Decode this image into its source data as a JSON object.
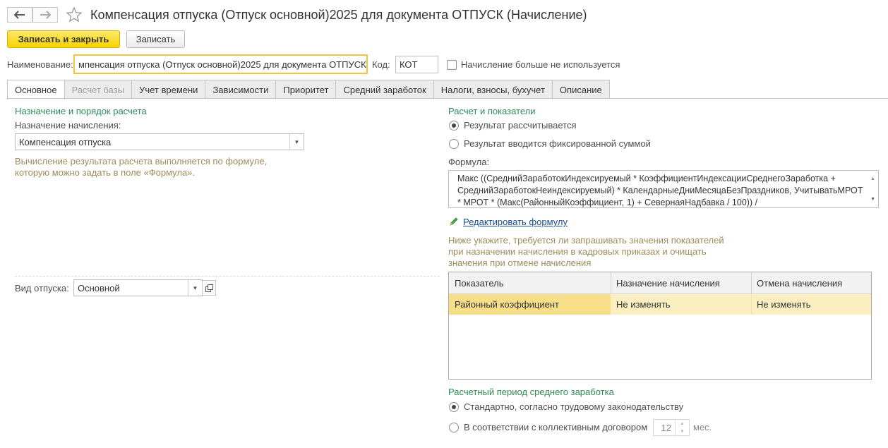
{
  "header": {
    "title": "Компенсация отпуска (Отпуск основной)2025 для документа ОТПУСК (Начисление)",
    "save_close_label": "Записать и закрыть",
    "save_label": "Записать"
  },
  "fields": {
    "name_label": "Наименование:",
    "name_value": "мпенсация отпуска (Отпуск основной)2025 для документа ОТПУСК",
    "code_label": "Код:",
    "code_value": "КОТ",
    "unused_label": "Начисление больше не используется"
  },
  "tabs": [
    {
      "label": "Основное"
    },
    {
      "label": "Расчет базы"
    },
    {
      "label": "Учет времени"
    },
    {
      "label": "Зависимости"
    },
    {
      "label": "Приоритет"
    },
    {
      "label": "Средний заработок"
    },
    {
      "label": "Налоги, взносы, бухучет"
    },
    {
      "label": "Описание"
    }
  ],
  "left": {
    "section_title": "Назначение и порядок расчета",
    "purpose_label": "Назначение начисления:",
    "purpose_value": "Компенсация отпуска",
    "hint": "Вычисление результата расчета выполняется по формуле, которую можно задать в поле «Формула».",
    "vacation_kind_label": "Вид отпуска:",
    "vacation_kind_value": "Основной"
  },
  "right": {
    "section_title": "Расчет и показатели",
    "radio_calculated": "Результат рассчитывается",
    "radio_fixed": "Результат вводится фиксированной суммой",
    "formula_label": "Формула:",
    "formula_text": "Макс ((СреднийЗаработокИндексируемый * КоэффициентИндексацииСреднегоЗаработка + СреднийЗаработокНеиндексируемый) * КалендарныеДниМесяцаБезПраздников, УчитыватьМРОТ * МРОТ * (Макс(РайонныйКоэффициент, 1) + СевернаяНадбавка / 100)) /",
    "edit_formula_link": "Редактировать формулу",
    "note": "Ниже укажите, требуется ли запрашивать значения показателей при назначении начисления в кадровых приказах и очищать значения при отмене начисления",
    "table": {
      "columns": [
        "Показатель",
        "Назначение начисления",
        "Отмена начисления"
      ],
      "rows": [
        [
          "Районный коэффициент",
          "Не изменять",
          "Не изменять"
        ]
      ]
    },
    "period_title": "Расчетный период среднего заработка",
    "period_standard": "Стандартно, согласно трудовому законодательству",
    "period_contract": "В соответствии с коллективным договором",
    "months_value": "12",
    "months_unit": "мес."
  }
}
